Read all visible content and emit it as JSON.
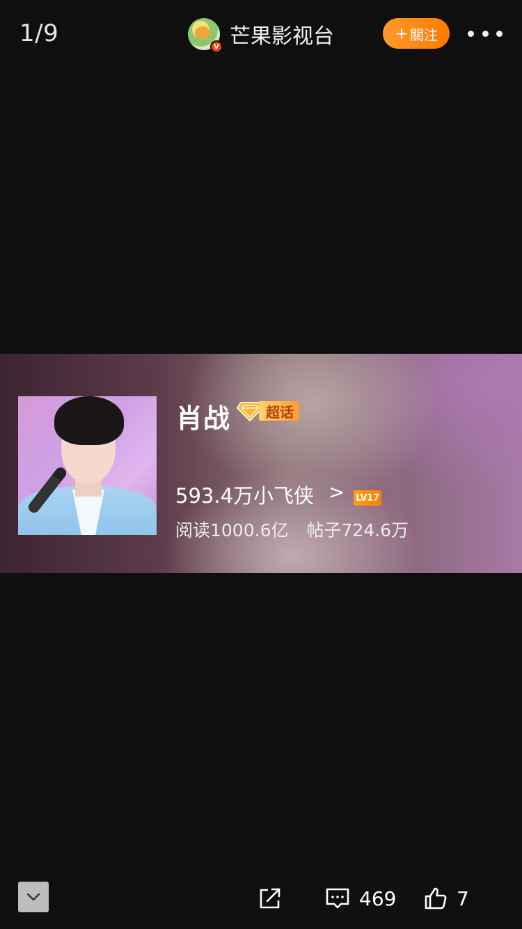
{
  "header": {
    "page_counter": "1/9",
    "author_name": "芒果影视台",
    "verified_mark": "V",
    "follow_label": "關注",
    "follow_plus": "+"
  },
  "topic_card": {
    "name": "肖战",
    "super_label": "超话",
    "fans_text": "593.4万小飞侠",
    "fans_arrow": ">",
    "level": "LV17",
    "reads": "阅读1000.6亿",
    "posts": "帖子724.6万"
  },
  "bottom_bar": {
    "comment_count": "469",
    "like_count": "7"
  },
  "colors": {
    "background": "#0f0f0f",
    "follow_button": "#ff8a14",
    "level_badge": "#ff8c00",
    "verified_badge": "#f5450c"
  },
  "icons": {
    "collapse": "chevron-down-icon",
    "share": "share-icon",
    "comment": "comment-icon",
    "like": "thumbs-up-icon",
    "more": "more-dots-icon",
    "super": "diamond-icon"
  }
}
